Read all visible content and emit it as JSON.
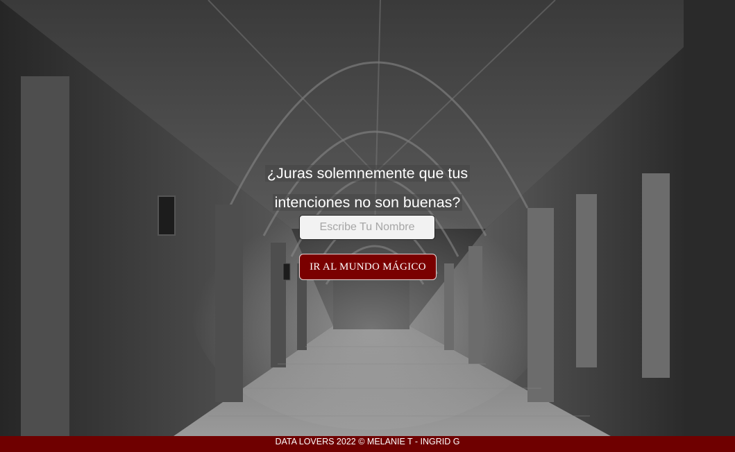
{
  "prompt": {
    "line1": "¿Juras solemnemente que tus",
    "line2": "intenciones no son buenas?"
  },
  "name_input": {
    "placeholder": "Escribe Tu Nombre",
    "value": ""
  },
  "go_button": {
    "label": "IR AL MUNDO MÁGICO"
  },
  "footer": {
    "text": "DATA LOVERS 2022 © MELANIE T - INGRID G"
  },
  "colors": {
    "accent": "#7a0000",
    "footer": "#6f0000"
  },
  "background": {
    "description_icon": "cloister-corridor-photo"
  }
}
